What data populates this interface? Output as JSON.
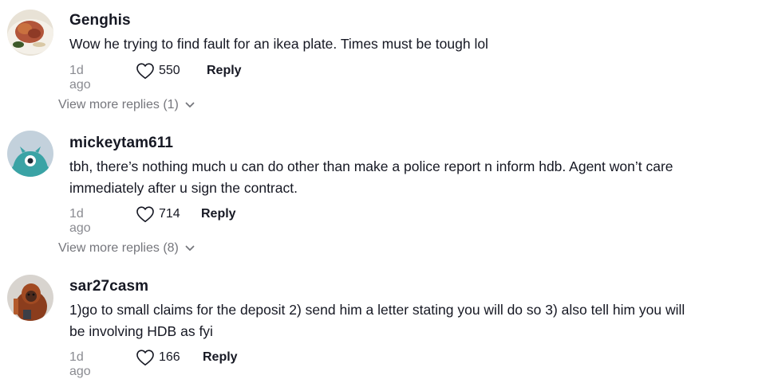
{
  "comments": [
    {
      "username": "Genghis",
      "avatar_icon": "food-plate-avatar",
      "lines": [
        "Wow he trying to find fault for an ikea plate. Times must be tough lol"
      ],
      "time": "1d ago",
      "likes": "550",
      "reply_label": "Reply",
      "view_more": "View more replies (1)"
    },
    {
      "username": "mickeytam611",
      "avatar_icon": "teal-monster-avatar",
      "lines": [
        "tbh, there’s nothing much u can do other than make a police report n inform hdb. Agent won’t care",
        "immediately after u sign the contract."
      ],
      "time": "1d ago",
      "likes": "714",
      "reply_label": "Reply",
      "view_more": "View more replies (8)"
    },
    {
      "username": "sar27casm",
      "avatar_icon": "orangutan-avatar",
      "lines": [
        "1)go to small claims for the deposit 2) send him a letter stating you will do so 3) also tell him you will",
        "be involving HDB as fyi"
      ],
      "time": "1d ago",
      "likes": "166",
      "reply_label": "Reply"
    }
  ],
  "colors": {
    "text": "#161823",
    "muted": "#8a8b91",
    "view_more": "#75767c",
    "avatar2_bg": "#c3d1dc",
    "avatar2_monster": "#3aa3a5"
  }
}
